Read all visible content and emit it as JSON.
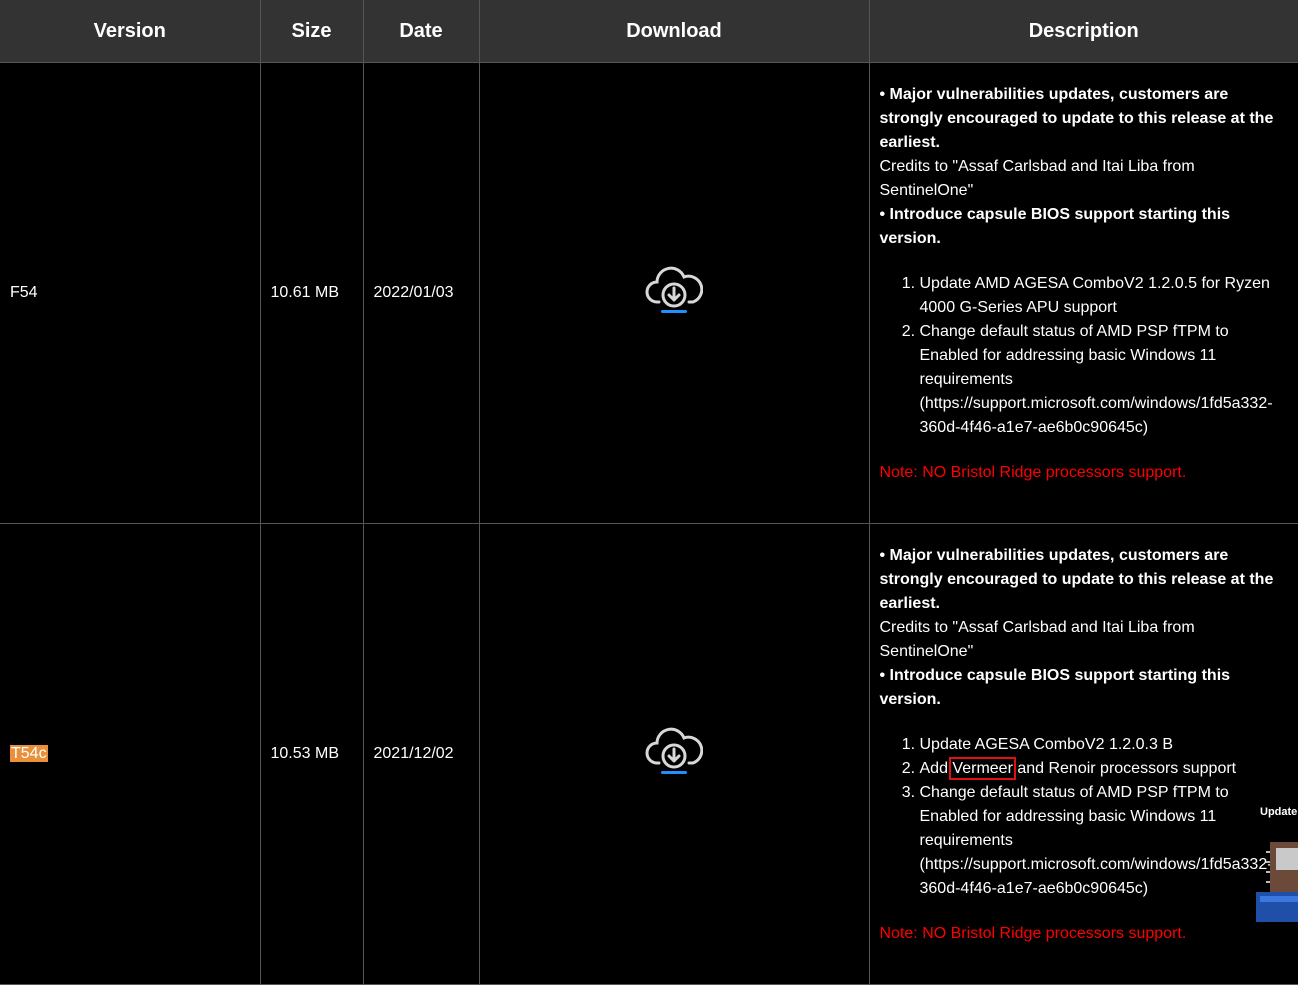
{
  "table": {
    "headers": [
      "Version",
      "Size",
      "Date",
      "Download",
      "Description"
    ],
    "rows": [
      {
        "version": "F54",
        "size": "10.61 MB",
        "date": "2022/01/03",
        "desc_bold1": "• Major vulnerabilities updates, customers are strongly encouraged to update to this release at the earliest.",
        "desc_credits": "Credits to \"Assaf Carlsbad and Itai Liba from SentinelOne\"",
        "desc_bold2": "• Introduce capsule BIOS support starting this version.",
        "items": [
          "Update AMD AGESA ComboV2 1.2.0.5 for Ryzen 4000 G-Series APU support",
          "Change default status of AMD PSP fTPM to Enabled for addressing basic Windows 11 requirements (https://support.microsoft.com/windows/1fd5a332-360d-4f46-a1e7-ae6b0c90645c)"
        ],
        "note": "Note: NO Bristol Ridge processors support."
      },
      {
        "version": "T54c",
        "size": "10.53 MB",
        "date": "2021/12/02",
        "desc_bold1": "• Major vulnerabilities updates, customers are strongly encouraged to update to this release at the earliest.",
        "desc_credits": "Credits to \"Assaf Carlsbad and Itai Liba from SentinelOne\"",
        "desc_bold2": "• Introduce capsule BIOS support starting this version.",
        "item1": "Update AGESA ComboV2 1.2.0.3 B",
        "item2_pre": "Add ",
        "item2_highlight": "Vermeer",
        "item2_post": " and Renoir processors support",
        "item3": "Change default status of AMD PSP fTPM to Enabled for addressing basic Windows 11 requirements (https://support.microsoft.com/windows/1fd5a332-360d-4f46-a1e7-ae6b0c90645c)",
        "note": "Note: NO Bristol Ridge processors support."
      }
    ]
  },
  "overlay": {
    "label": "Update"
  },
  "icons": {
    "download": "cloud-download-icon"
  },
  "colors": {
    "header_bg": "#333333",
    "note": "#ff0000",
    "highlight": "#e8903a",
    "accent": "#1e90ff"
  }
}
